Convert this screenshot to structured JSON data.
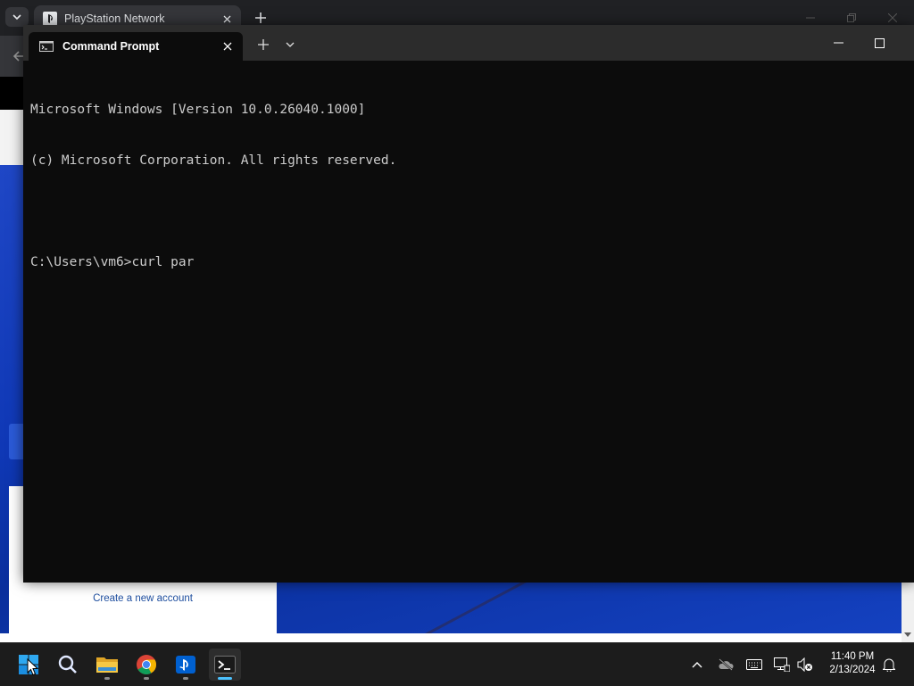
{
  "browser": {
    "tab_title": "PlayStation Network",
    "create_account_link": "Create a new account"
  },
  "terminal": {
    "tab_title": "Command Prompt",
    "lines": [
      "Microsoft Windows [Version 10.0.26040.1000]",
      "(c) Microsoft Corporation. All rights reserved.",
      "",
      "C:\\Users\\vm6>curl par"
    ]
  },
  "taskbar": {
    "apps": [
      {
        "name": "start-button",
        "icon": "windows-logo-icon"
      },
      {
        "name": "search-button",
        "icon": "search-icon"
      },
      {
        "name": "file-explorer-button",
        "icon": "folder-icon"
      },
      {
        "name": "chrome-button",
        "icon": "chrome-icon"
      },
      {
        "name": "playstation-app-button",
        "icon": "playstation-icon"
      },
      {
        "name": "terminal-button",
        "icon": "terminal-icon"
      }
    ],
    "clock": {
      "time": "11:40 PM",
      "date": "2/13/2024"
    }
  },
  "colors": {
    "terminal_bg": "#0c0c0c",
    "terminal_text": "#cccccc",
    "hero_blue": "#1441c0",
    "link_blue": "#1f4fa0",
    "active_indicator": "#4cc2ff"
  }
}
